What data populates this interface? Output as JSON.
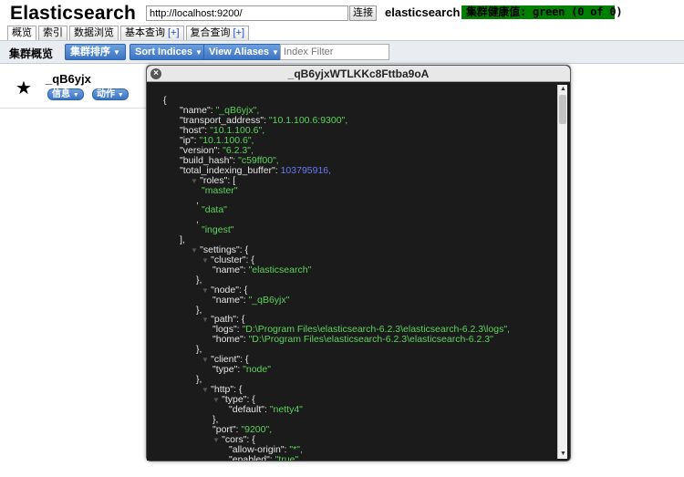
{
  "header": {
    "app_title": "Elasticsearch",
    "url_value": "http://localhost:9200/",
    "connect_label": "连接",
    "cluster_name": "elasticsearch",
    "health_label": "集群健康值: green (0 of 0)"
  },
  "tabs": [
    {
      "label": "概览",
      "active": true
    },
    {
      "label": "索引",
      "active": false
    },
    {
      "label": "数据浏览",
      "active": false
    },
    {
      "label": "基本查询",
      "plus": "[+]",
      "active": false
    },
    {
      "label": "复合查询",
      "plus": "[+]",
      "active": false
    }
  ],
  "toolbar": {
    "title": "集群概览",
    "sort_cluster_label": "集群排序",
    "sort_indices_label": "Sort Indices",
    "view_aliases_label": "View Aliases",
    "index_filter_placeholder": "Index Filter"
  },
  "node": {
    "name": "_qB6yjx",
    "info_label": "信息",
    "actions_label": "动作"
  },
  "dialog": {
    "title": "_qB6yjxWTLKKc8Fttba9oA",
    "close_icon": "close-icon"
  },
  "json_lines": [
    {
      "t": "{"
    },
    {
      "k": "\"name\": ",
      "s": "\"_qB6yjx\","
    },
    {
      "k": "\"transport_address\": ",
      "s": "\"10.1.100.6:9300\","
    },
    {
      "k": "\"host\": ",
      "s": "\"10.1.100.6\","
    },
    {
      "k": "\"ip\": ",
      "s": "\"10.1.100.6\","
    },
    {
      "k": "\"version\": ",
      "s": "\"6.2.3\","
    },
    {
      "k": "\"build_hash\": ",
      "s": "\"c59ff00\","
    },
    {
      "k": "\"total_indexing_buffer\": ",
      "n": "103795916,"
    },
    {
      "k": "\"roles\": ["
    },
    {
      "s": "\"master\""
    },
    {
      "t": ","
    },
    {
      "s": "\"data\""
    },
    {
      "t": ","
    },
    {
      "s": "\"ingest\""
    },
    {
      "t": "],"
    },
    {
      "k": "\"settings\": {"
    },
    {
      "k": "\"cluster\": {"
    },
    {
      "k": "\"name\": ",
      "s": "\"elasticsearch\""
    },
    {
      "t": "},"
    },
    {
      "k": "\"node\": {"
    },
    {
      "k": "\"name\": ",
      "s": "\"_qB6yjx\""
    },
    {
      "t": "},"
    },
    {
      "k": "\"path\": {"
    },
    {
      "k": "\"logs\": ",
      "s": "\"D:\\Program Files\\elasticsearch-6.2.3\\elasticsearch-6.2.3\\logs\","
    },
    {
      "k": "\"home\": ",
      "s": "\"D:\\Program Files\\elasticsearch-6.2.3\\elasticsearch-6.2.3\""
    },
    {
      "t": "},"
    },
    {
      "k": "\"client\": {"
    },
    {
      "k": "\"type\": ",
      "s": "\"node\""
    },
    {
      "t": "},"
    },
    {
      "k": "\"http\": {"
    },
    {
      "k": "\"type\": {"
    },
    {
      "k": "\"default\": ",
      "s": "\"netty4\""
    },
    {
      "t": "},"
    },
    {
      "k": "\"port\": ",
      "s": "\"9200\","
    },
    {
      "k": "\"cors\": {"
    },
    {
      "k": "\"allow-origin\": ",
      "s": "\"*\","
    },
    {
      "k": "\"enabled\": ",
      "s": "\"true\""
    }
  ],
  "colors": {
    "health_green": "#008000",
    "json_string": "#5ed45e",
    "json_number": "#6a7bf5",
    "dialog_bg": "#1b1b1b",
    "button_blue": "#3b73c4"
  }
}
